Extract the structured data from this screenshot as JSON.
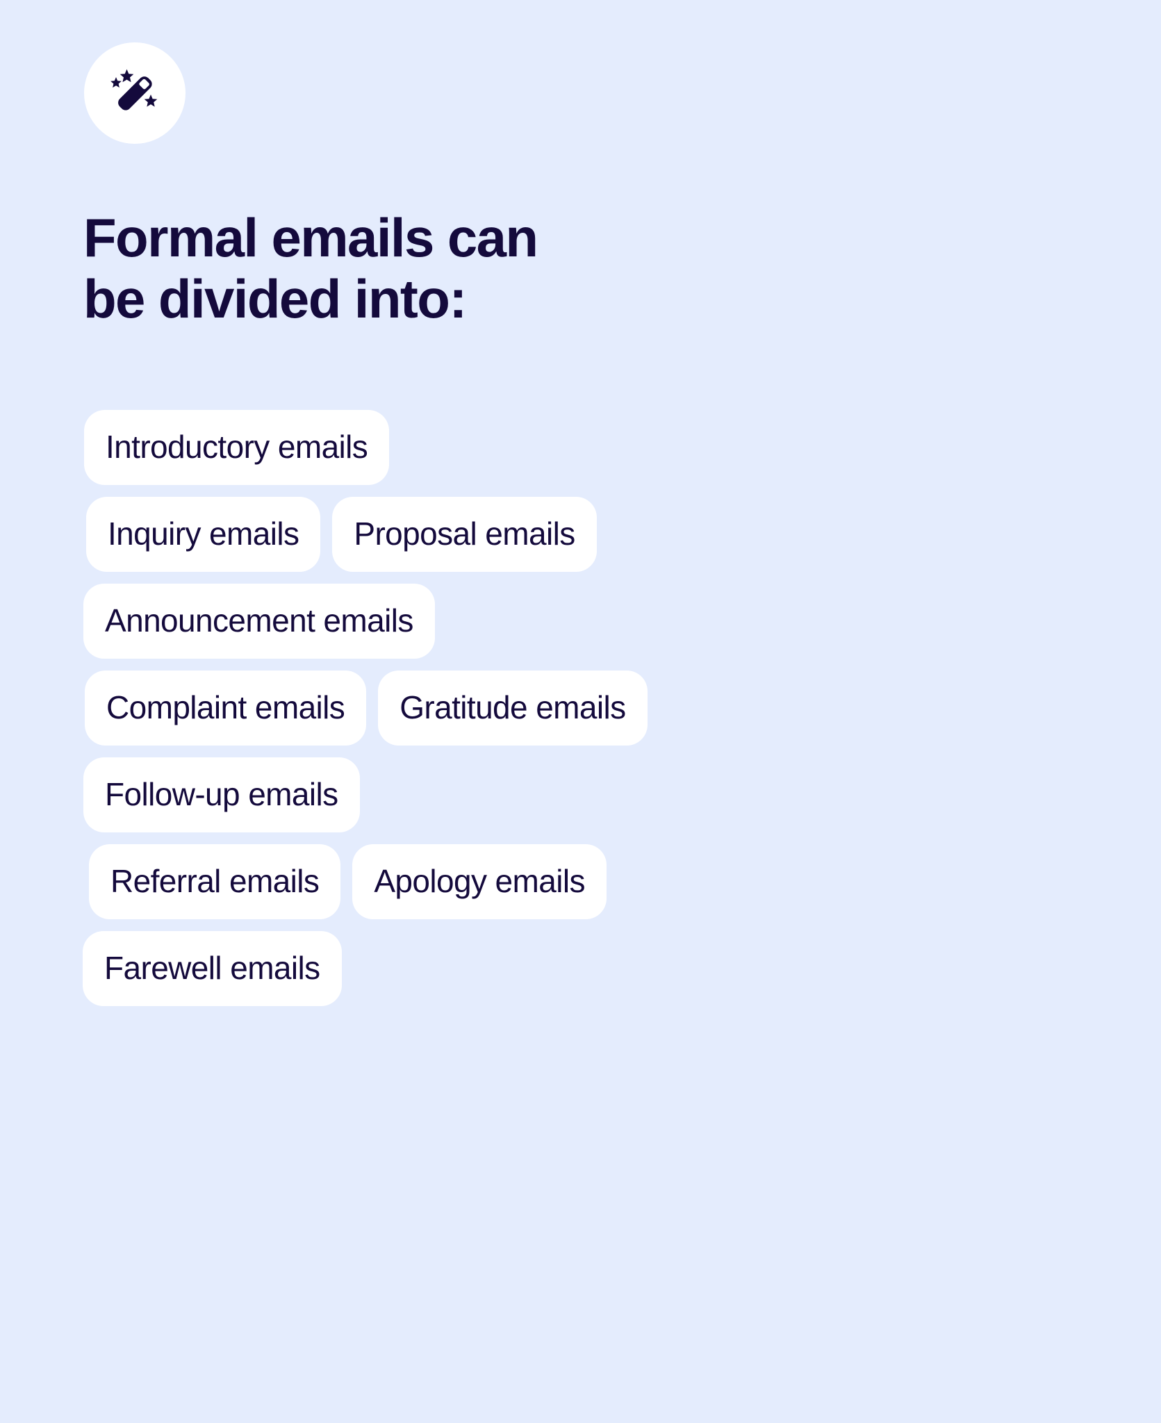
{
  "colors": {
    "background": "#e4ecfd",
    "card": "#ffffff",
    "text_dark": "#140a3c"
  },
  "badge": {
    "icon": "magic-wand-icon"
  },
  "heading": {
    "text": "Formal emails can\nbe divided into:",
    "line1": "Formal emails can",
    "line2": "be divided into:"
  },
  "chip_rows": [
    {
      "chips": [
        {
          "label": "Introductory emails"
        }
      ]
    },
    {
      "chips": [
        {
          "label": "Inquiry emails"
        },
        {
          "label": "Proposal emails"
        }
      ]
    },
    {
      "chips": [
        {
          "label": "Announcement emails"
        }
      ]
    },
    {
      "chips": [
        {
          "label": "Complaint emails"
        },
        {
          "label": "Gratitude emails"
        }
      ]
    },
    {
      "chips": [
        {
          "label": "Follow-up emails"
        }
      ]
    },
    {
      "chips": [
        {
          "label": "Referral emails"
        },
        {
          "label": "Apology emails"
        }
      ]
    },
    {
      "chips": [
        {
          "label": "Farewell emails"
        }
      ]
    }
  ],
  "chips_flat": [
    "Introductory emails",
    "Inquiry emails",
    "Proposal emails",
    "Announcement emails",
    "Complaint emails",
    "Gratitude emails",
    "Follow-up emails",
    "Referral emails",
    "Apology emails",
    "Farewell emails"
  ]
}
